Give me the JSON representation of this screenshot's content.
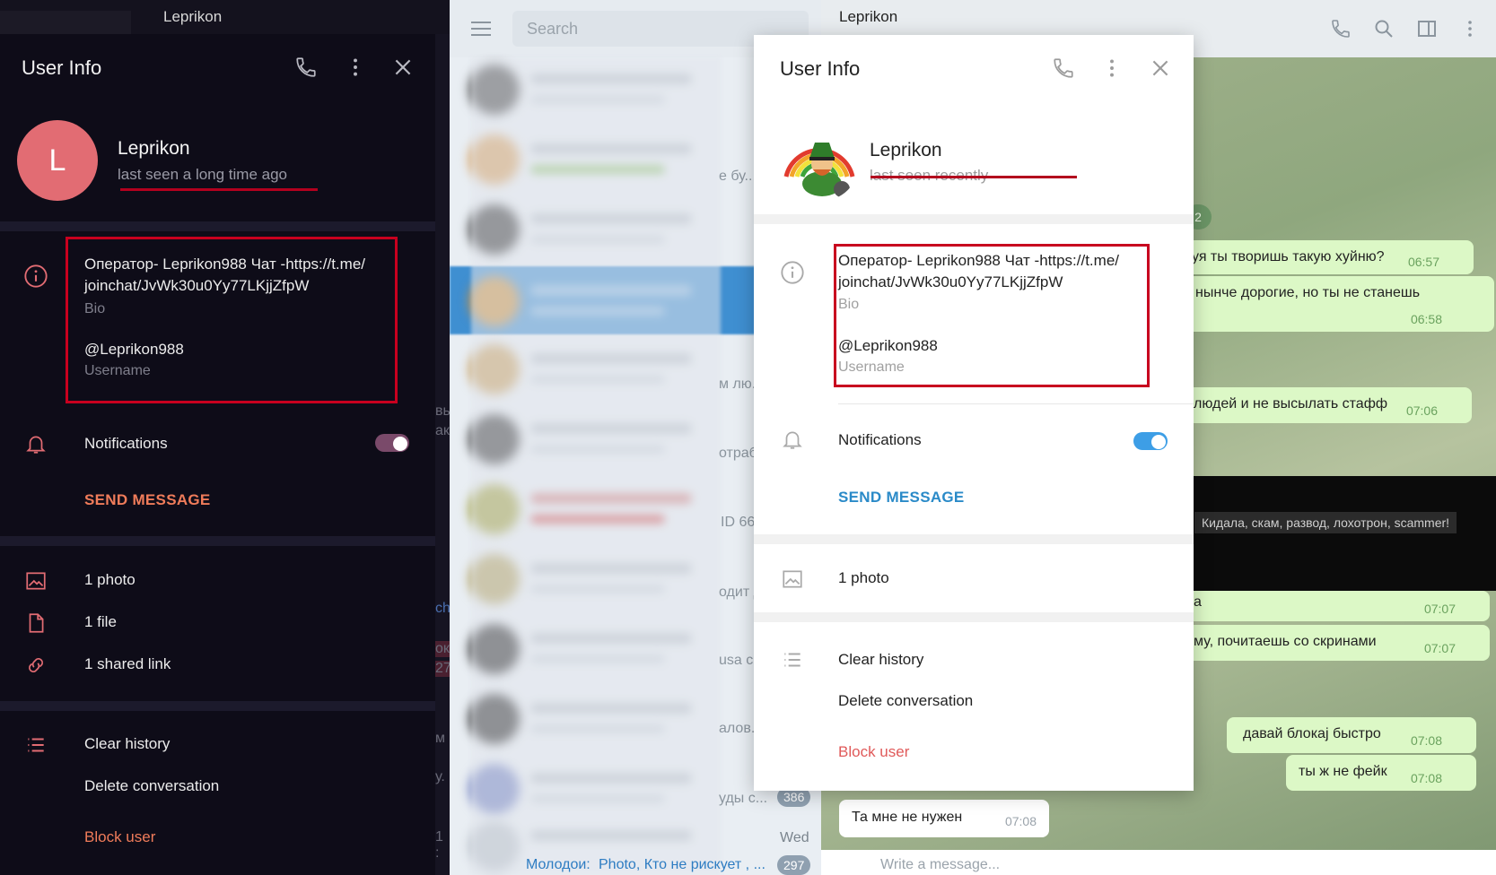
{
  "dark_panel": {
    "window_title": "Leprikon",
    "title": "User Info",
    "avatar_letter": "L",
    "name": "Leprikon",
    "status": "last seen a long time ago",
    "bio_line1": "Оператор- Leprikon988 Чат -https://t.me/",
    "bio_line2": "joinchat/JvWk30u0Yy77LKjjZfpW",
    "bio_label": "Bio",
    "username": "@Leprikon988",
    "username_label": "Username",
    "notifications": "Notifications",
    "notifications_on": true,
    "send_message": "SEND MESSAGE",
    "media": [
      {
        "label": "1 photo",
        "icon": "photo-icon"
      },
      {
        "label": "1 file",
        "icon": "file-icon"
      },
      {
        "label": "1 shared link",
        "icon": "link-icon"
      }
    ],
    "clear_history": "Clear history",
    "delete_conversation": "Delete conversation",
    "block_user": "Block user",
    "gutter_text": [
      "вь",
      "ака",
      "ch",
      "ок",
      "27",
      "м",
      "у.",
      "1 :"
    ],
    "colors": {
      "accent": "#f07c5a",
      "icon": "#e26c73",
      "bg": "#0e0c18"
    }
  },
  "chat_list": {
    "search_placeholder": "Search",
    "snippets": [
      "е бу...",
      "м лю...",
      "отраб",
      "ID 66",
      "одит д",
      "usa с",
      "алов...",
      "уды с..."
    ],
    "badge": "386",
    "day": "Wed",
    "bottom_item_sender": "Молодои:",
    "bottom_item_text": "Photo, Кто не рискует , ...",
    "bottom_badge": "297"
  },
  "chat": {
    "title": "Leprikon",
    "date_pill": "2",
    "messages": [
      {
        "text": "уя ты творишь такую хуйню?",
        "time": "06:57"
      },
      {
        "text": "нынче дорогие, но ты не станешь",
        "time": "06:58"
      },
      {
        "text": "людей и не высылать стафф",
        "time": "07:06"
      },
      {
        "text": "а",
        "time": "07:07"
      },
      {
        "text": "му, почитаешь со скринами",
        "time": "07:07"
      },
      {
        "text": "давай блокаj быстро",
        "time": "07:08"
      },
      {
        "text": "ты ж не фейк",
        "time": "07:08"
      }
    ],
    "media_caption": "Кидала, скам, развод, лохотрон, scammer!",
    "incoming": {
      "text": "Та мне не нужен",
      "time": "07:08"
    },
    "input_placeholder": "Write a message..."
  },
  "modal": {
    "title": "User Info",
    "name": "Leprikon",
    "status": "last seen recently",
    "bio_line1": "Оператор- Leprikon988 Чат -https://t.me/",
    "bio_line2": "joinchat/JvWk30u0Yy77LKjjZfpW",
    "bio_label": "Bio",
    "username": "@Leprikon988",
    "username_label": "Username",
    "notifications": "Notifications",
    "notifications_on": true,
    "send_message": "SEND MESSAGE",
    "photos": "1 photo",
    "clear_history": "Clear history",
    "delete_conversation": "Delete conversation",
    "block_user": "Block user",
    "colors": {
      "accent": "#2a8ac8",
      "danger": "#e05a5a",
      "icon": "#a9a9a9",
      "toggle": "#3d9ee6"
    }
  },
  "annotation_color": "#b3001e"
}
